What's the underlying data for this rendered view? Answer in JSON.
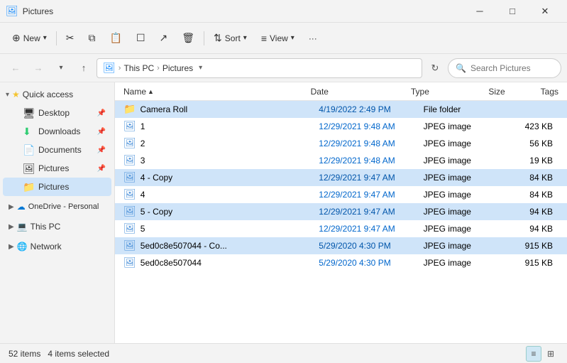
{
  "titleBar": {
    "icon": "🖼",
    "title": "Pictures",
    "minimize": "─",
    "maximize": "□",
    "close": "✕"
  },
  "toolbar": {
    "new_label": "New",
    "sort_label": "Sort",
    "view_label": "View",
    "more_label": "···"
  },
  "addressBar": {
    "back_tooltip": "Back",
    "forward_tooltip": "Forward",
    "recent_tooltip": "Recent",
    "up_tooltip": "Up",
    "path_icon": "🖼",
    "path_parts": [
      "This PC",
      "Pictures"
    ],
    "search_placeholder": "Search Pictures"
  },
  "sidebar": {
    "quick_access_label": "Quick access",
    "items": [
      {
        "id": "desktop",
        "label": "Desktop",
        "icon": "🖥",
        "pinned": true
      },
      {
        "id": "downloads",
        "label": "Downloads",
        "icon": "⬇",
        "pinned": true
      },
      {
        "id": "documents",
        "label": "Documents",
        "icon": "📄",
        "pinned": true
      },
      {
        "id": "pictures1",
        "label": "Pictures",
        "icon": "🖼",
        "pinned": true
      },
      {
        "id": "pictures2",
        "label": "Pictures",
        "icon": "📁",
        "pinned": false
      }
    ],
    "onedrive_label": "OneDrive - Personal",
    "thispc_label": "This PC",
    "network_label": "Network"
  },
  "columns": {
    "name": "Name",
    "date": "Date",
    "type": "Type",
    "size": "Size",
    "tags": "Tags"
  },
  "files": [
    {
      "id": 1,
      "name": "Camera Roll",
      "icon": "folder",
      "date": "4/19/2022 2:49 PM",
      "type": "File folder",
      "size": "",
      "tags": "",
      "selected": true
    },
    {
      "id": 2,
      "name": "1",
      "icon": "jpeg",
      "date": "12/29/2021 9:48 AM",
      "type": "JPEG image",
      "size": "423 KB",
      "tags": "",
      "selected": false
    },
    {
      "id": 3,
      "name": "2",
      "icon": "jpeg",
      "date": "12/29/2021 9:48 AM",
      "type": "JPEG image",
      "size": "56 KB",
      "tags": "",
      "selected": false
    },
    {
      "id": 4,
      "name": "3",
      "icon": "jpeg",
      "date": "12/29/2021 9:48 AM",
      "type": "JPEG image",
      "size": "19 KB",
      "tags": "",
      "selected": false
    },
    {
      "id": 5,
      "name": "4 - Copy",
      "icon": "jpeg",
      "date": "12/29/2021 9:47 AM",
      "type": "JPEG image",
      "size": "84 KB",
      "tags": "",
      "selected": true
    },
    {
      "id": 6,
      "name": "4",
      "icon": "jpeg",
      "date": "12/29/2021 9:47 AM",
      "type": "JPEG image",
      "size": "84 KB",
      "tags": "",
      "selected": false
    },
    {
      "id": 7,
      "name": "5 - Copy",
      "icon": "jpeg",
      "date": "12/29/2021 9:47 AM",
      "type": "JPEG image",
      "size": "94 KB",
      "tags": "",
      "selected": true
    },
    {
      "id": 8,
      "name": "5",
      "icon": "jpeg",
      "date": "12/29/2021 9:47 AM",
      "type": "JPEG image",
      "size": "94 KB",
      "tags": "",
      "selected": false
    },
    {
      "id": 9,
      "name": "5ed0c8e507044 - Co...",
      "icon": "jpeg",
      "date": "5/29/2020 4:30 PM",
      "type": "JPEG image",
      "size": "915 KB",
      "tags": "",
      "selected": true
    },
    {
      "id": 10,
      "name": "5ed0c8e507044",
      "icon": "jpeg",
      "date": "5/29/2020 4:30 PM",
      "type": "JPEG image",
      "size": "915 KB",
      "tags": "",
      "selected": false
    }
  ],
  "statusBar": {
    "items_count": "52 items",
    "selected_count": "4 items selected"
  }
}
